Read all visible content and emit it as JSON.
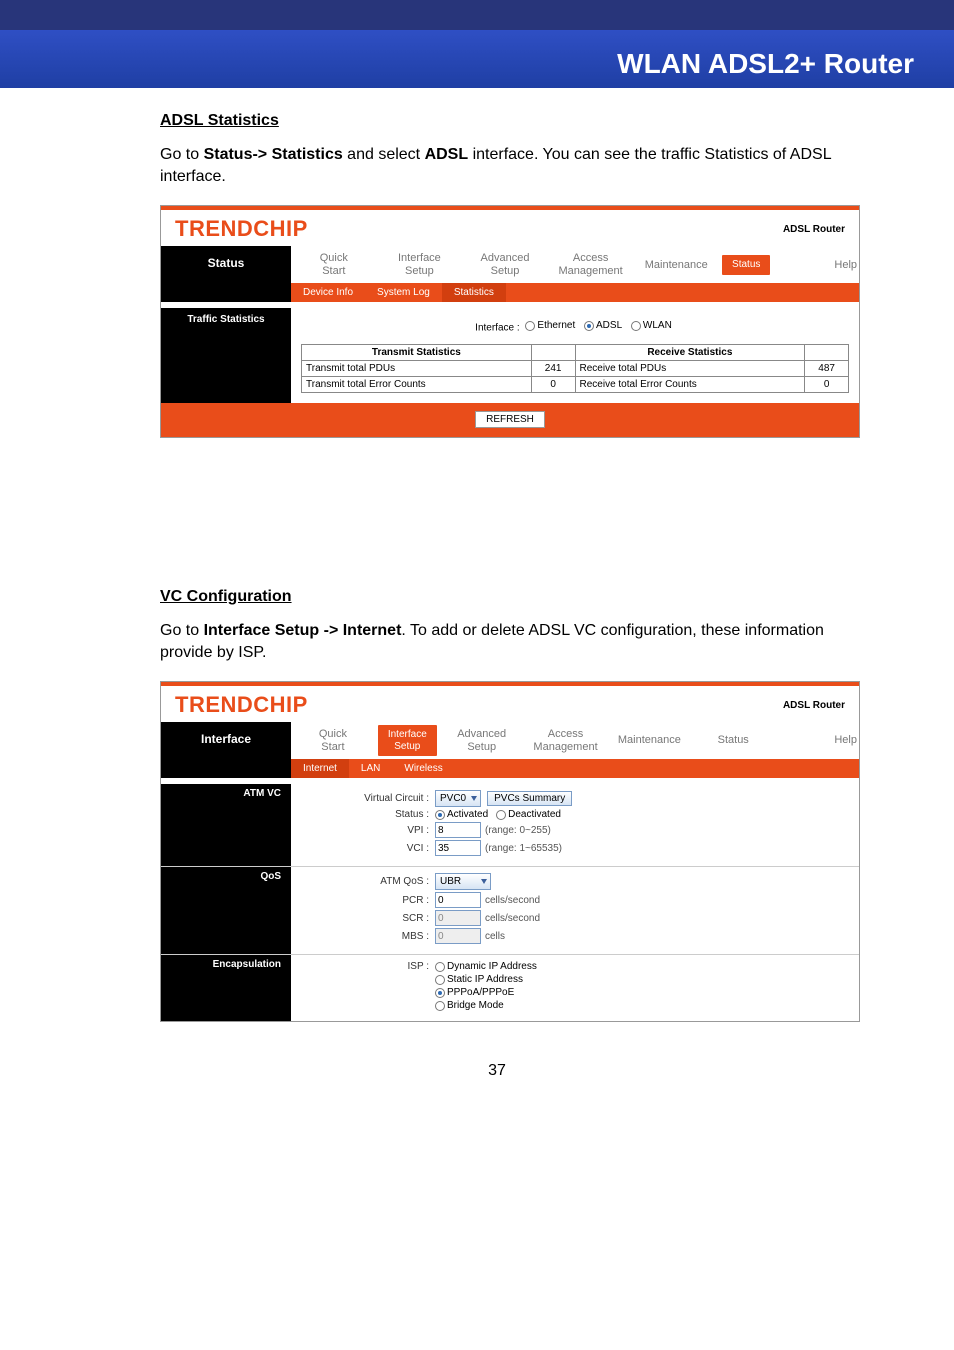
{
  "banner": {
    "title": "WLAN ADSL2+ Router"
  },
  "page_number": "37",
  "sec1": {
    "heading": "ADSL Statistics",
    "para_pre": "Go to ",
    "para_b1": "Status-> Statistics",
    "para_mid": " and select ",
    "para_b2": "ADSL",
    "para_post": " interface. You can see the traffic Statistics of ADSL interface."
  },
  "shot1": {
    "brand": "TRENDCHIP",
    "router_label": "ADSL Router",
    "left_title": "Status",
    "tabs": [
      "Quick\nStart",
      "Interface\nSetup",
      "Advanced\nSetup",
      "Access\nManagement",
      "Maintenance",
      "Status",
      "Help"
    ],
    "active_pill": "Status",
    "subtabs": [
      "Device Info",
      "System Log",
      "Statistics"
    ],
    "active_sub": "Statistics",
    "left_sub": "Traffic Statistics",
    "if_label": "Interface :",
    "if_opts": [
      "Ethernet",
      "ADSL",
      "WLAN"
    ],
    "tx_head": "Transmit Statistics",
    "rx_head": "Receive Statistics",
    "rows": [
      {
        "tl": "Transmit total PDUs",
        "tv": "241",
        "rl": "Receive total PDUs",
        "rv": "487"
      },
      {
        "tl": "Transmit total Error Counts",
        "tv": "0",
        "rl": "Receive total Error Counts",
        "rv": "0"
      }
    ],
    "refresh": "REFRESH"
  },
  "sec2": {
    "heading": "VC Configuration",
    "para_pre": "Go to ",
    "para_b1": "Interface Setup -> Internet",
    "para_post": ". To add or delete ADSL VC configuration, these information provide by ISP."
  },
  "shot2": {
    "brand": "TRENDCHIP",
    "router_label": "ADSL Router",
    "left_title": "Interface",
    "tabs": [
      "Quick\nStart",
      "Interface\nSetup",
      "Advanced\nSetup",
      "Access\nManagement",
      "Maintenance",
      "Status",
      "Help"
    ],
    "active_pill": "Interface\nSetup",
    "subtabs": [
      "Internet",
      "LAN",
      "Wireless"
    ],
    "active_sub": "Internet",
    "sec_atm": "ATM VC",
    "vc_label": "Virtual Circuit :",
    "vc_value": "PVC0",
    "vc_btn": "PVCs Summary",
    "status_label": "Status :",
    "status_opts": [
      "Activated",
      "Deactivated"
    ],
    "vpi_label": "VPI :",
    "vpi_val": "8",
    "vpi_hint": "(range: 0~255)",
    "vci_label": "VCI :",
    "vci_val": "35",
    "vci_hint": "(range: 1~65535)",
    "sec_qos": "QoS",
    "qos_label": "ATM QoS :",
    "qos_val": "UBR",
    "pcr_label": "PCR :",
    "pcr_val": "0",
    "pcr_unit": "cells/second",
    "scr_label": "SCR :",
    "scr_val": "0",
    "scr_unit": "cells/second",
    "mbs_label": "MBS :",
    "mbs_val": "0",
    "mbs_unit": "cells",
    "sec_encap": "Encapsulation",
    "isp_label": "ISP :",
    "isp_opts": [
      "Dynamic IP Address",
      "Static IP Address",
      "PPPoA/PPPoE",
      "Bridge Mode"
    ],
    "isp_selected": "PPPoA/PPPoE"
  }
}
